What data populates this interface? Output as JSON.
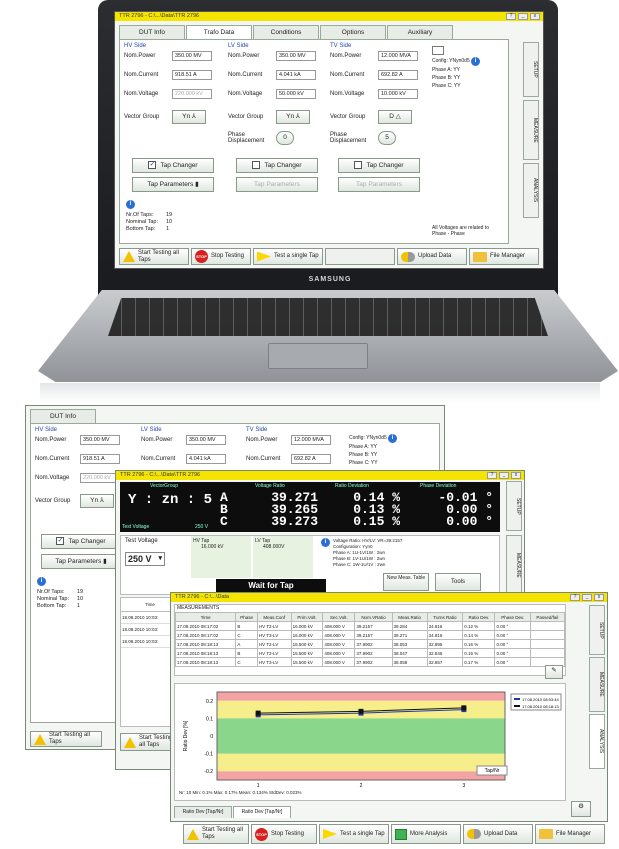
{
  "app_title": "TTR 2796 - C:\\...\\Data\\TTR 2796",
  "tabs": [
    "DUT Info",
    "Trafo Data",
    "Conditions",
    "Options",
    "Auxiliary"
  ],
  "hv": {
    "title": "HV Side",
    "power_label": "Nom.Power",
    "power": "350.00 MV",
    "current_label": "Nom.Current",
    "current": "918.51 A",
    "voltage_label": "Nom.Voltage",
    "voltage": "220.000 kV",
    "vg_label": "Vector Group",
    "vg": "Yn"
  },
  "lv": {
    "title": "LV Side",
    "power_label": "Nom.Power",
    "power": "350.00 MV",
    "current_label": "Nom.Current",
    "current": "4.041 kA",
    "voltage_label": "Nom.Voltage",
    "voltage": "50.000 kV",
    "vg_label": "Vector Group",
    "vg": "Yn",
    "phase_label": "Phase Displacement",
    "phase": "0"
  },
  "tv": {
    "title": "TV Side",
    "power_label": "Nom.Power",
    "power": "12.000 MVA",
    "current_label": "Nom.Current",
    "current": "692.82 A",
    "voltage_label": "Nom.Voltage",
    "voltage": "10.000 kV",
    "vg_label": "Vector Group",
    "vg": "D",
    "phase_label": "Phase Displacement",
    "phase": "5"
  },
  "config": {
    "config_label": "Config:",
    "config_val": "YNyn0d5",
    "phase_a": "Phase A: YY",
    "phase_b": "Phase B: YY",
    "phase_c": "Phase C: YY"
  },
  "tap_changer_label": "Tap Changer",
  "tap_params_label": "Tap Parameters",
  "taps": {
    "nr_label": "Nr.Of Taps:",
    "nr": "19",
    "nominal_label": "Nominal Tap:",
    "nominal": "10",
    "bottom_label": "Bottom Tap:",
    "bottom": "1"
  },
  "voltages_note": "All Voltages are related to Phase - Phase",
  "side_tabs": [
    "SETUP",
    "MEASURE",
    "ANALYSIS"
  ],
  "bottom_buttons": {
    "start_all": "Start Testing all Taps",
    "stop": "Stop Testing",
    "test_single": "Test a single Tap",
    "more_analysis": "More Analysis",
    "upload": "Upload Data",
    "file_manager": "File Manager"
  },
  "stop_icon_text": "STOP",
  "brand": "SAMSUNG",
  "measure": {
    "headers": [
      "VectorGroup",
      "Voltage Ratio",
      "Ratio Deviation",
      "Phase Deviation"
    ],
    "vector_group": "Y : zn :  5",
    "rows": [
      {
        "phase": "A",
        "ratio": "39.271",
        "dev": "0.14 %",
        "pdev": "-0.01 °"
      },
      {
        "phase": "B",
        "ratio": "39.265",
        "dev": "0.13 %",
        "pdev": "0.00 °"
      },
      {
        "phase": "C",
        "ratio": "39.273",
        "dev": "0.15 %",
        "pdev": "0.00 °"
      }
    ],
    "test_voltage_label": "Test Voltage",
    "test_voltage_small": "250 V",
    "hv_tap_label": "HV Tap",
    "hv_tap": "16.000 kV",
    "lv_tap_label": "LV Tap",
    "lv_tap": "408.000V",
    "test_voltage_select": "250 V",
    "voltage_ratio_line": "Voltage Ratio: HV/LV: VR=39.2157",
    "configuration_line": "Configuration: Yyn0",
    "phase_lines": [
      "Phase A: 1U-1V/1W : 2wn",
      "Phase B: 1V-1U/1W : 2wn",
      "Phase C: 1W-1U/1V : 2wn"
    ],
    "wait_label": "Wait for Tap",
    "new_meas_label": "New Meas. Table",
    "tools_label": "Tools",
    "time_header": "Time",
    "time_rows": [
      "18.08.2010 10:03:",
      "18.08.2010 10:03:",
      "18.08.2010 10:03:"
    ]
  },
  "analysis": {
    "title": "TTR 2796 - C:\\...\\Data",
    "table_title": "MEASUREMENTS",
    "headers": [
      "Time",
      "Phase",
      "Meas.Conf",
      "Prim.Volt.",
      "Sec.Volt.",
      "Nom.VRatio",
      "Meas.Ratio",
      "Turns Ratio",
      "Ratio Dev.",
      "Phase Dev.",
      "Passed/fail"
    ],
    "rows": [
      [
        "17.08.2010 08:17:02",
        "B",
        "HV T2-LV",
        "16.000 kV",
        "408.000 V",
        "39.2157",
        "39.284",
        "34.816",
        "0.12 %",
        "0.00 °",
        ""
      ],
      [
        "17.08.2010 08:17:02",
        "C",
        "HV T3-LV",
        "16.000 kV",
        "408.000 V",
        "39.2157",
        "39.271",
        "34.816",
        "0.14 %",
        "0.00 °",
        ""
      ],
      [
        "17.08.2010 08:18:13",
        "A",
        "HV T2-LV",
        "15.500 kV",
        "408.000 V",
        "37.9902",
        "38.053",
        "32.895",
        "0.16 %",
        "0.00 °",
        ""
      ],
      [
        "17.08.2010 08:18:13",
        "B",
        "HV T2-LV",
        "15.500 kV",
        "408.000 V",
        "37.9902",
        "38.047",
        "32.846",
        "0.15 %",
        "0.00 °",
        ""
      ],
      [
        "17.08.2010 08:18:13",
        "C",
        "HV T3-LV",
        "15.500 kV",
        "408.000 V",
        "37.9902",
        "38.058",
        "32.857",
        "0.17 %",
        "0.00 °",
        ""
      ]
    ],
    "stats": "Nr: 10  Min:  0.1%  Max:  0.17%  Mean: 0.134%  StdDev: 0.023%",
    "bottom_tabs": [
      "Ratio Dev [Tap/Nr]",
      "Ratio Dev [Tap/Nr]"
    ]
  },
  "chart_data": {
    "type": "line",
    "ylabel": "Ratio Dev [%]",
    "xlabel": "Tap/Nr",
    "x": [
      1,
      2,
      3
    ],
    "xticks": [
      "1",
      "2",
      "3"
    ],
    "ylim": [
      -0.25,
      0.25
    ],
    "yticks": [
      "0.2",
      "0.1",
      "0",
      "-0.1",
      "-0.2"
    ],
    "bands": {
      "red": [
        0.2,
        0.25
      ],
      "yellow": [
        0.1,
        0.2
      ],
      "green": [
        -0.1,
        0.1
      ]
    },
    "series": [
      {
        "name": "17.08.2010 08:03:44",
        "color": "#1a3aa8",
        "values": [
          0.12,
          0.13,
          0.15
        ]
      },
      {
        "name": "17.08.2010 08:18:13",
        "color": "#111111",
        "values": [
          0.13,
          0.14,
          0.16
        ]
      }
    ]
  },
  "colors": {
    "titlebar": "#f4e400",
    "measure_bg": "#0d0d0d",
    "band_red": "#f3a3a3",
    "band_yellow": "#f6ee8a",
    "band_green": "#8ad68a"
  }
}
